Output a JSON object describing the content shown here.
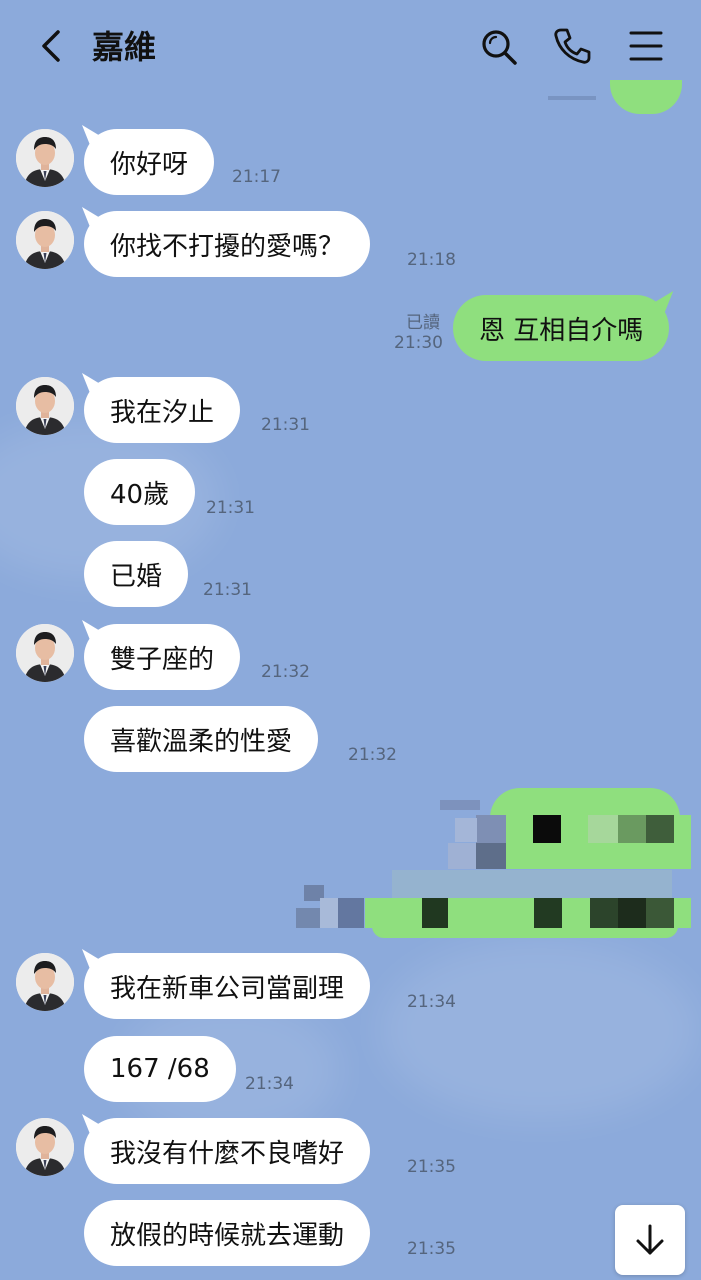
{
  "header": {
    "title": "嘉維",
    "icons": [
      "back-icon",
      "search-icon",
      "phone-icon",
      "menu-icon"
    ]
  },
  "messages": [
    {
      "text": "你好呀",
      "time": "21:17"
    },
    {
      "text": "你找不打擾的愛嗎？",
      "time": "21:18"
    },
    {
      "text": "恩 互相自介嗎",
      "time": "21:30",
      "read": "已讀"
    },
    {
      "text": "我在汐止",
      "time": "21:31"
    },
    {
      "text": "40歲",
      "time": "21:31"
    },
    {
      "text": "已婚",
      "time": "21:31"
    },
    {
      "text": "雙子座的",
      "time": "21:32"
    },
    {
      "text": "喜歡溫柔的性愛",
      "time": "21:32"
    },
    {
      "text": "我在新車公司當副理",
      "time": "21:34"
    },
    {
      "text": "167 /68",
      "time": "21:34"
    },
    {
      "text": "我沒有什麼不良嗜好",
      "time": "21:35"
    },
    {
      "text": "放假的時候就去運動",
      "time": "21:35"
    }
  ],
  "colors": {
    "background": "#8caadb",
    "incoming_bubble": "#ffffff",
    "outgoing_bubble": "#8fdf7e",
    "meta_text": "#55657d"
  },
  "scroll_button": {
    "icon": "arrow-down-icon"
  }
}
